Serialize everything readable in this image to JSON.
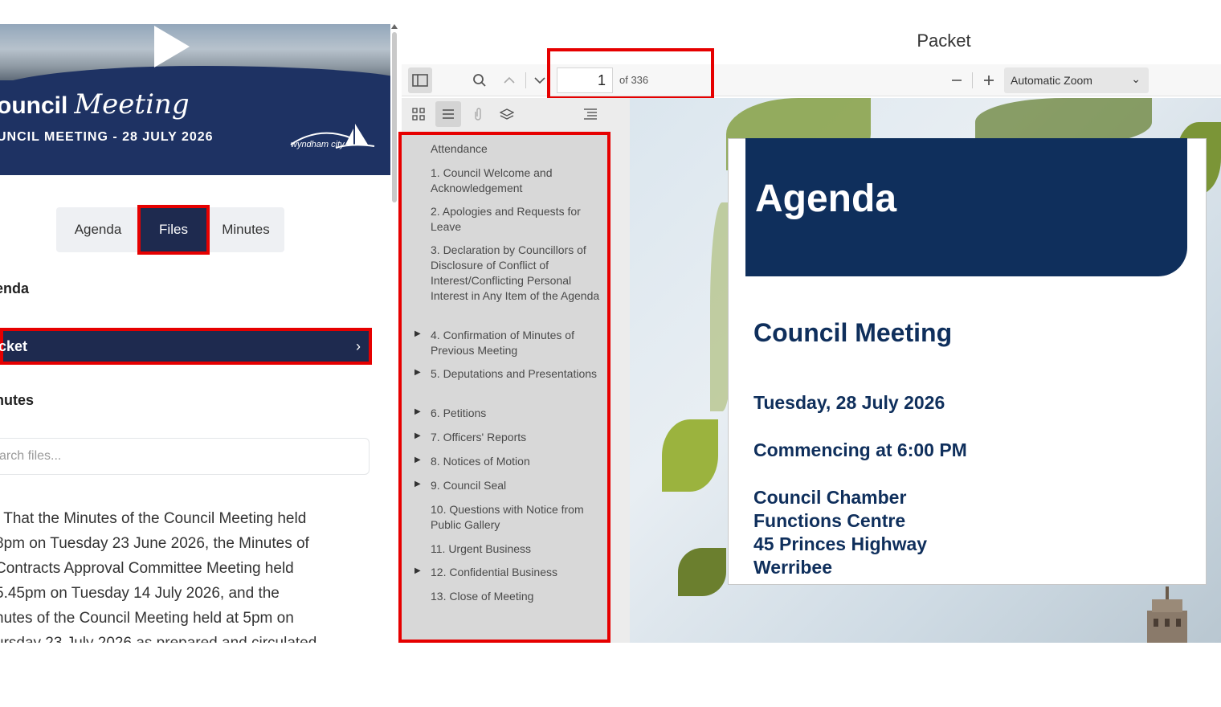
{
  "banner": {
    "title_bold": "ouncil",
    "title_script": "Meeting",
    "subtitle": "UNCIL MEETING - 28 JULY 2026",
    "logo_text": "wyndham city"
  },
  "tabs": [
    {
      "label": "Agenda"
    },
    {
      "label": "Files"
    },
    {
      "label": "Minutes"
    }
  ],
  "files": {
    "agenda_heading": "enda",
    "packet_label": "cket",
    "packet_chevron": "›",
    "minutes_heading": "nutes",
    "search_placeholder": "arch files..."
  },
  "minutes_text": {
    "lines": [
      ". That the Minutes of the Council Meeting held",
      "8pm on Tuesday 23 June 2026, the Minutes of",
      " Contracts Approval Committee Meeting held",
      "5.45pm on Tuesday 14 July 2026, and the",
      "nutes of the Council Meeting held at 5pm on",
      "ursday 23 July 2026 as prepared and circulated"
    ]
  },
  "viewer": {
    "title": "Packet",
    "page_current": "1",
    "page_of": "of 336",
    "zoom": "Automatic Zoom"
  },
  "outline": [
    {
      "text": "Attendance",
      "expandable": false
    },
    {
      "text": "1. Council Welcome and Acknowledgement",
      "expandable": false
    },
    {
      "text": "2. Apologies and Requests for Leave",
      "expandable": false
    },
    {
      "text": "3. Declaration by Councillors of Disclosure of Conflict of Interest/Conflicting Personal Interest in Any Item of the Agenda",
      "expandable": false
    },
    {
      "text": "4. Confirmation of Minutes of Previous Meeting",
      "expandable": true
    },
    {
      "text": "5. Deputations and Presentations",
      "expandable": true
    },
    {
      "text": "6. Petitions",
      "expandable": true
    },
    {
      "text": "7. Officers' Reports",
      "expandable": true
    },
    {
      "text": "8. Notices of Motion",
      "expandable": true
    },
    {
      "text": "9. Council Seal",
      "expandable": true
    },
    {
      "text": "10. Questions with Notice from Public Gallery",
      "expandable": false
    },
    {
      "text": "11. Urgent Business",
      "expandable": false
    },
    {
      "text": "12. Confidential Business",
      "expandable": true
    },
    {
      "text": "13. Close of Meeting",
      "expandable": false
    }
  ],
  "document": {
    "heading": "Agenda",
    "meeting": "Council Meeting",
    "date": "Tuesday, 28 July 2026",
    "time": "Commencing at 6:00 PM",
    "venue_lines": [
      "Council Chamber",
      "Functions Centre",
      "45 Princes Highway",
      "Werribee"
    ]
  },
  "colors": {
    "navy": "#1e2a4f",
    "doc_navy": "#0f2f5c",
    "highlight_red": "#e60000"
  }
}
